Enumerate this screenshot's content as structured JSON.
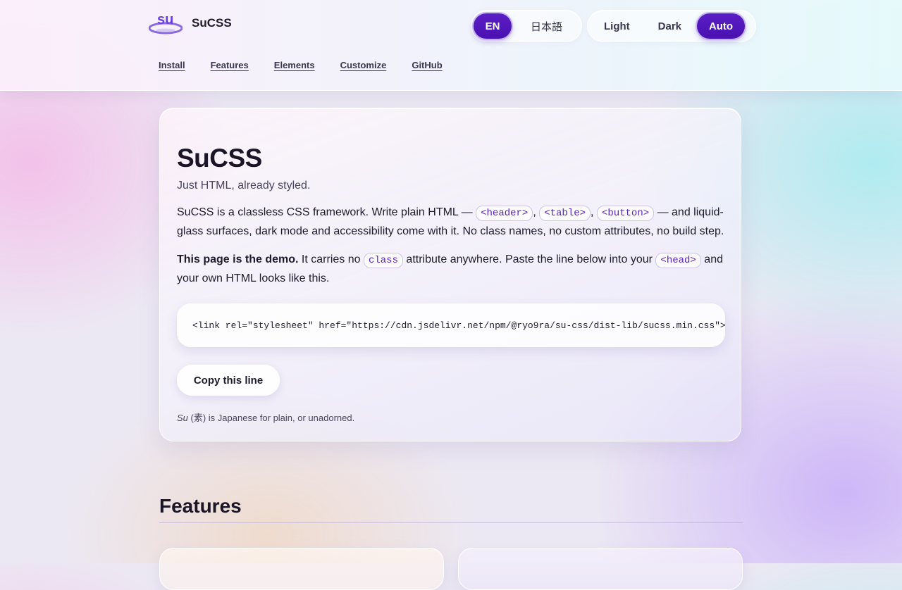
{
  "header": {
    "brand_mark": "su",
    "brand_name": "SuCSS",
    "languages": [
      {
        "label": "EN",
        "active": true
      },
      {
        "label": "日本語",
        "active": false
      }
    ],
    "themes": [
      {
        "label": "Light",
        "active": false
      },
      {
        "label": "Dark",
        "active": false
      },
      {
        "label": "Auto",
        "active": true
      }
    ],
    "nav": [
      "Install",
      "Features",
      "Elements",
      "Customize",
      "GitHub"
    ]
  },
  "hero": {
    "title": "SuCSS",
    "tagline": "Just HTML, already styled.",
    "p1": {
      "t1": "SuCSS is a classless CSS framework. Write plain HTML — ",
      "code1": "<header>",
      "sep1": ", ",
      "code2": "<table>",
      "sep2": ", ",
      "code3": "<button>",
      "t2": " — and liquid-glass surfaces, dark mode and accessibility come with it. No class names, no custom attributes, no build step."
    },
    "p2": {
      "strong": "This page is the demo.",
      "t1": " It carries no ",
      "code1": "class",
      "t2": " attribute anywhere. Paste the line below into your ",
      "code2": "<head>",
      "t3": " and your own HTML looks like this."
    },
    "snippet": "<link rel=\"stylesheet\" href=\"https://cdn.jsdelivr.net/npm/@ryo9ra/su-css/dist-lib/sucss.min.css\">",
    "copy_label": "Copy this line",
    "footnote": {
      "em": "Su",
      "rest": " (素) is Japanese for plain, or unadorned."
    }
  },
  "features": {
    "title": "Features"
  },
  "colors": {
    "accent": "#4a10b0",
    "text": "#1e1b2e",
    "code": "#5a22b8"
  }
}
